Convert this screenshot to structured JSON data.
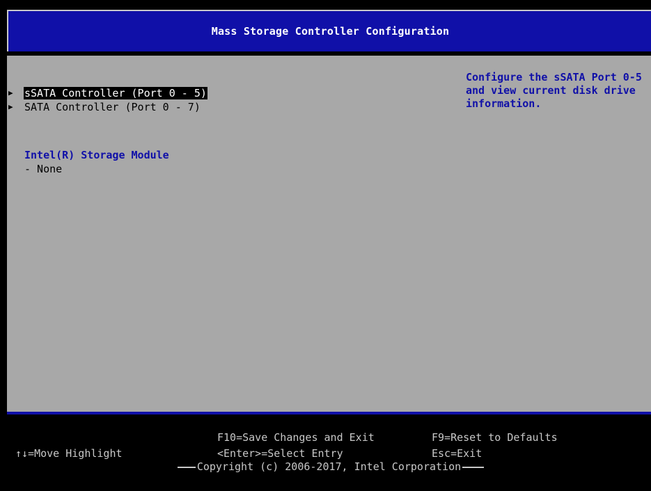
{
  "header": {
    "title": "Mass Storage Controller Configuration"
  },
  "menu": {
    "items": [
      {
        "label": "sSATA Controller (Port 0 - 5)",
        "selected": true
      },
      {
        "label": "SATA Controller (Port 0 - 7)",
        "selected": false
      }
    ],
    "arrow": "▶"
  },
  "section": {
    "title": "Intel(R) Storage Module",
    "value": "- None"
  },
  "help": {
    "lines": [
      "Configure the sSATA Port 0-5",
      "and view current disk drive",
      "information."
    ]
  },
  "footer": {
    "move": "↑↓=Move Highlight",
    "f10": "F10=Save Changes and Exit",
    "enter": "<Enter>=Select Entry",
    "f9": "F9=Reset to Defaults",
    "esc": "Esc=Exit",
    "copyright": "Copyright (c) 2006-2017, Intel Corporation"
  },
  "colors": {
    "background_gray": "#a8a8a8",
    "bios_blue": "#1010a8",
    "black": "#000000",
    "light_gray_text": "#c8c8c8"
  }
}
